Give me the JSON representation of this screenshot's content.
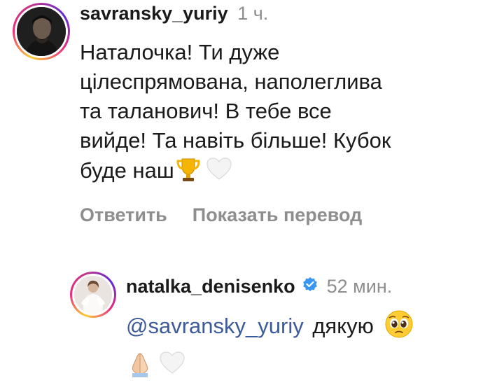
{
  "comments": [
    {
      "username": "savransky_yuriy",
      "time": "1 ч.",
      "text_lines": [
        "Наталочка! Ти дуже",
        "цілеспрямована, наполеглива",
        "та таланович! В тебе все",
        "вийде! Та навіть більше! Кубок",
        "буде наш"
      ],
      "reply_label": "Ответить",
      "translate_label": "Показать перевод",
      "icons": [
        "trophy-icon",
        "white-heart-icon"
      ]
    },
    {
      "username": "natalka_denisenko",
      "verified": true,
      "time": "52 мин.",
      "mention": "@savransky_yuriy",
      "text": "дякую",
      "icons": [
        "pleading-face-icon",
        "folded-hands-icon",
        "white-heart-icon"
      ]
    }
  ],
  "colors": {
    "mention": "#3c5a9a",
    "meta": "#8e8e8e",
    "verified": "#3897f0"
  }
}
